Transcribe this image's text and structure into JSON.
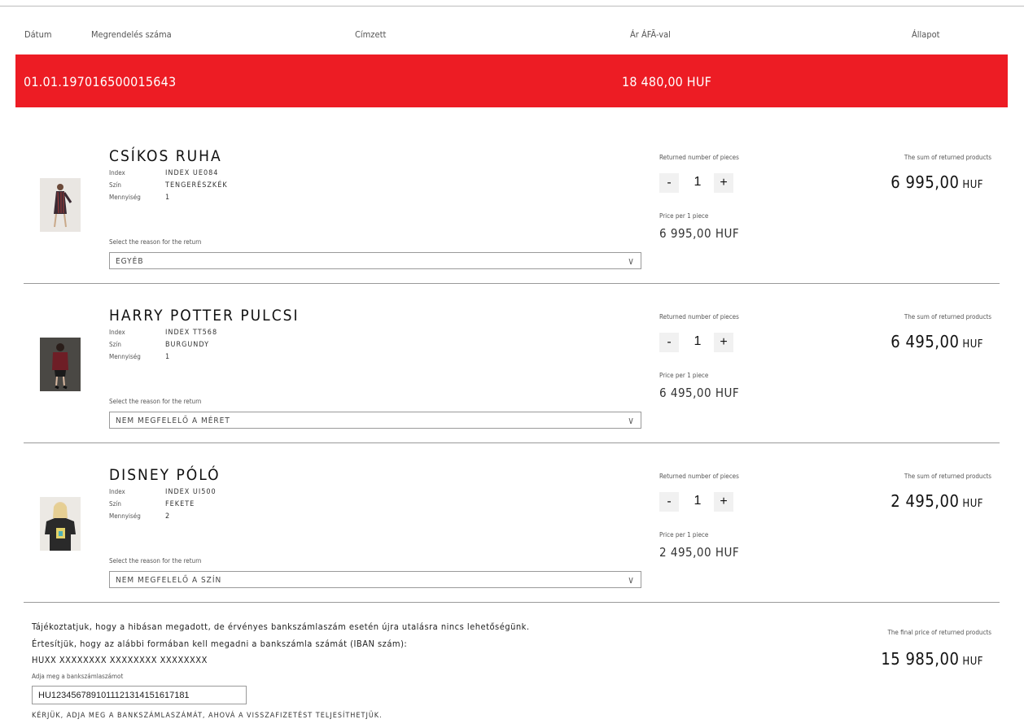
{
  "columns": {
    "date": "Dátum",
    "order_number": "Megrendelés száma",
    "recipient": "Címzett",
    "price_vat": "Ár ÁFÃ-val",
    "status": "Állapot"
  },
  "order": {
    "date_and_number": "01.01.197016500015643",
    "price": "18 480,00 HUF",
    "accent_color": "#ed1c24"
  },
  "labels": {
    "returned_pieces": "Returned number of pieces",
    "price_per_piece": "Price per 1 piece",
    "sum_returned": "The sum of returned products",
    "select_reason": "Select the reason for the return",
    "index": "Index",
    "color": "Szín",
    "quantity": "Mennyiség",
    "minus": "-",
    "plus": "+",
    "chevron": "∨",
    "currency": "HUF"
  },
  "items": [
    {
      "name": "CSÍKOS RUHA",
      "index": "INDEX UE084",
      "color": "TENGERÉSZKÉK",
      "quantity": "1",
      "reason": "EGYÉB",
      "returned_qty": "1",
      "price_per_piece": "6 995,00 HUF",
      "sum": "6 995,00"
    },
    {
      "name": "HARRY POTTER PULCSI",
      "index": "INDEX TT568",
      "color": "BURGUNDY",
      "quantity": "1",
      "reason": "NEM MEGFELELŐ A MÉRET",
      "returned_qty": "1",
      "price_per_piece": "6 495,00 HUF",
      "sum": "6 495,00"
    },
    {
      "name": "DISNEY PÓLÓ",
      "index": "INDEX UI500",
      "color": "FEKETE",
      "quantity": "2",
      "reason": "NEM MEGFELELŐ A SZÍN",
      "returned_qty": "1",
      "price_per_piece": "2 495,00 HUF",
      "sum": "2 495,00"
    }
  ],
  "footer": {
    "info_line1": "Tájékoztatjuk, hogy a hibásan megadott, de érvényes bankszámlaszám esetén újra utalásra nincs lehetőségünk.",
    "info_line2": "Értesítjük, hogy az alábbi formában kell megadni a bankszámla számát (IBAN szám):",
    "iban_format": "HUXX XXXXXXXX XXXXXXXX XXXXXXXX",
    "iban_label": "Adja meg a bankszámlaszámot",
    "iban_value": "HU12345678910111213141516171​81",
    "iban_hint": "KÉRJÜK, ADJA MEG A BANKSZÁMLASZÁMÁT, AHOVÁ A VISSZAFIZETÉST TELJESÍTHETJÜK.",
    "final_label": "The final price of returned products",
    "final_value": "15 985,00"
  }
}
